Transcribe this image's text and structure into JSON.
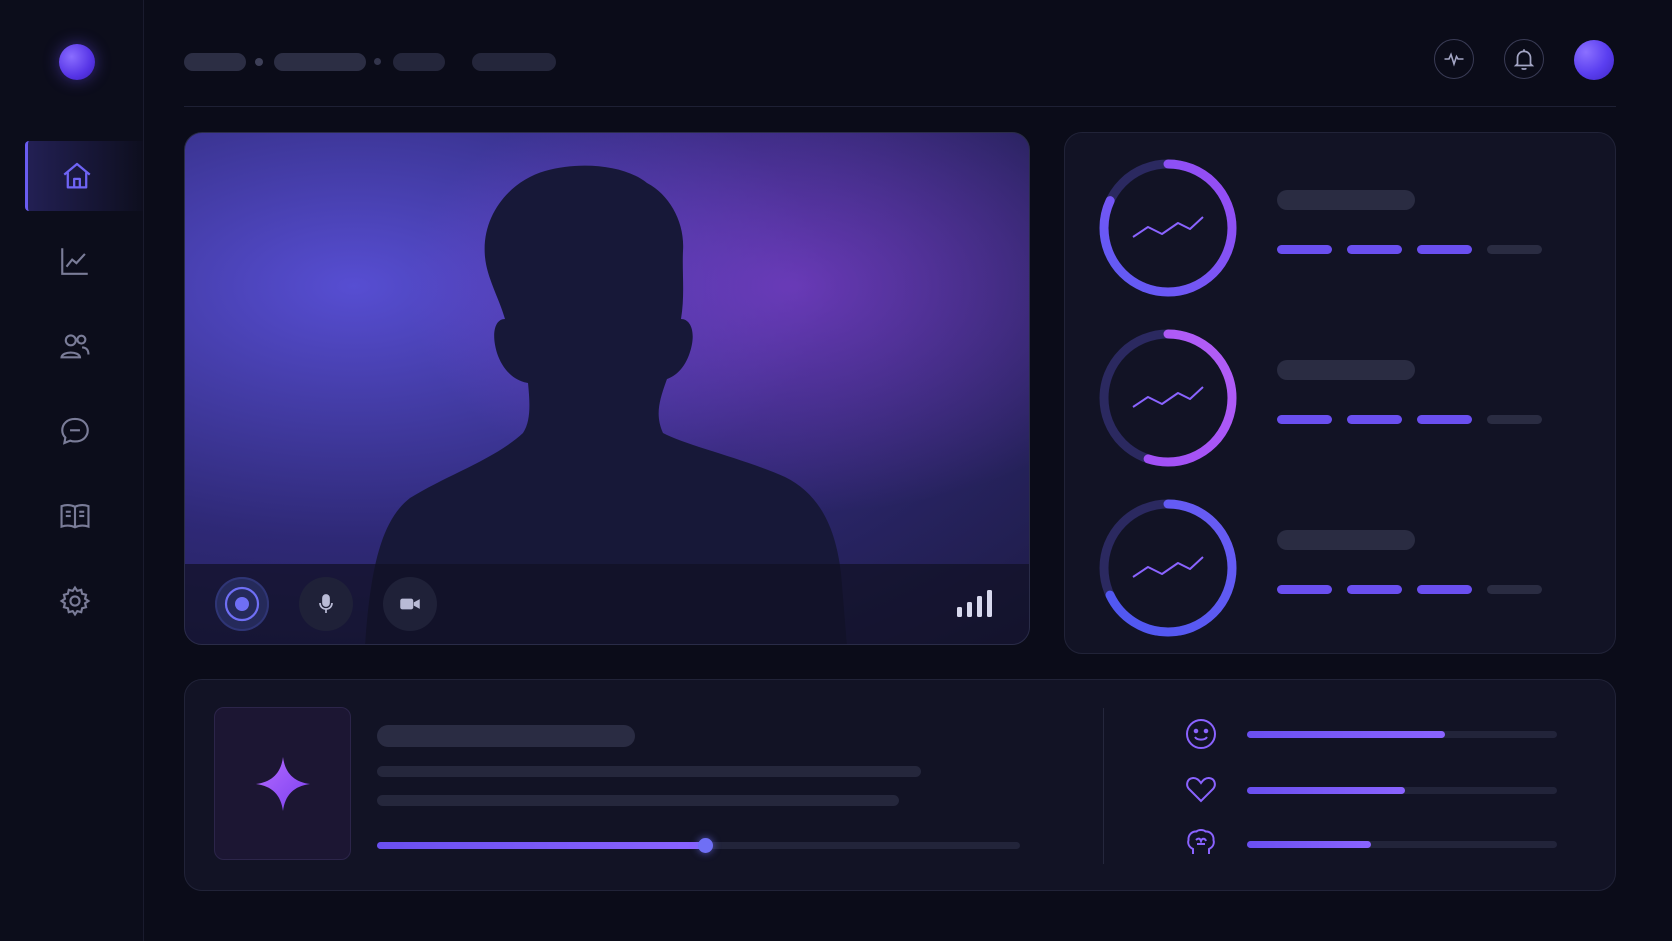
{
  "sidebar": {
    "logo": "brand-dot",
    "items": [
      {
        "name": "home",
        "icon": "home-icon",
        "active": true
      },
      {
        "name": "analytics",
        "icon": "line-chart-icon",
        "active": false
      },
      {
        "name": "users",
        "icon": "users-icon",
        "active": false
      },
      {
        "name": "messages",
        "icon": "chat-icon",
        "active": false
      },
      {
        "name": "library",
        "icon": "book-icon",
        "active": false
      },
      {
        "name": "settings",
        "icon": "gear-icon",
        "active": false
      }
    ]
  },
  "header": {
    "icons": [
      "activity-icon",
      "bell-icon"
    ],
    "avatar": "user-avatar"
  },
  "video": {
    "controls": [
      "record-icon",
      "microphone-icon",
      "video-camera-icon"
    ],
    "signal_bars": 4
  },
  "metrics": [
    {
      "icon": "trend-icon",
      "ring_progress": 0.82,
      "filled_dashes": 3,
      "total_dashes": 4
    },
    {
      "icon": "trend-icon",
      "ring_progress": 0.55,
      "filled_dashes": 3,
      "total_dashes": 4
    },
    {
      "icon": "trend-icon",
      "ring_progress": 0.68,
      "filled_dashes": 3,
      "total_dashes": 4
    }
  ],
  "insight": {
    "icon": "sparkle-icon",
    "progress": 0.51
  },
  "emotions": [
    {
      "icon": "smile-icon",
      "value": 0.64
    },
    {
      "icon": "heart-icon",
      "value": 0.51
    },
    {
      "icon": "brain-icon",
      "value": 0.4
    }
  ],
  "colors": {
    "accent": "#6a5cf0",
    "accent_purple": "#9d4cf5",
    "accent_blue": "#5b5cf5",
    "background": "#0b0c19",
    "panel": "#121325"
  }
}
